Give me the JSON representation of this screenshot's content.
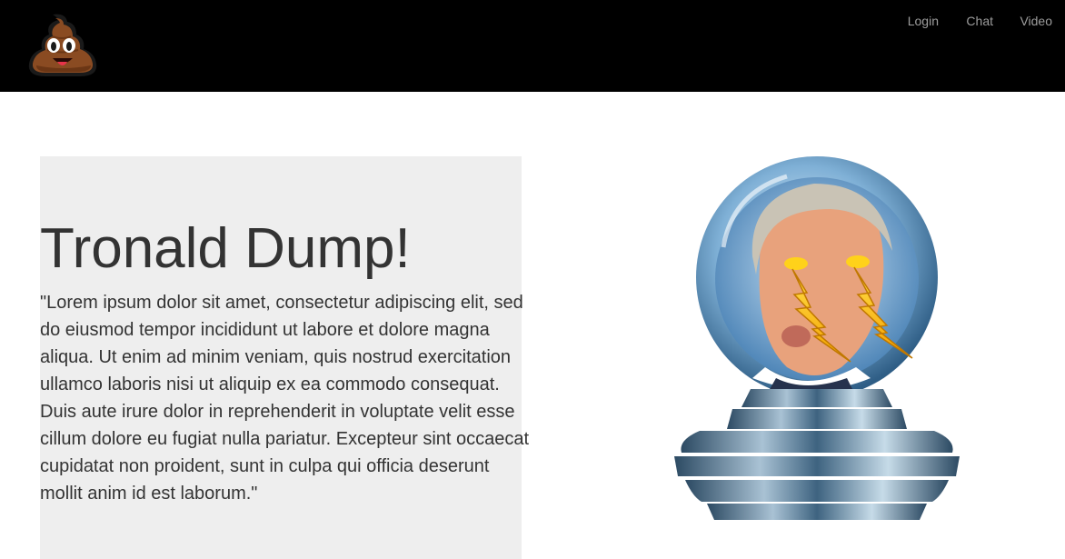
{
  "navbar": {
    "logo_icon": "poop-emoji-icon",
    "links": [
      {
        "label": "Login"
      },
      {
        "label": "Chat"
      },
      {
        "label": "Video"
      }
    ],
    "background_color": "#000000",
    "link_color": "#9d9d9d"
  },
  "hero": {
    "title": "Tronald Dump!",
    "body": "\"Lorem ipsum dolor sit amet, consectetur adipiscing elit, sed do eiusmod tempor incididunt ut labore et dolore magna aliqua. Ut enim ad minim veniam, quis nostrud exercitation ullamco laboris nisi ut aliquip ex ea commodo consequat. Duis aute irure dolor in reprehenderit in voluptate velit esse cillum dolore eu fugiat nulla pariatur. Excepteur sint occaecat cupidatat non proident, sunt in culpa qui officia deserunt mollit anim id est laborum.\"",
    "background_color": "#eeeeee"
  },
  "image": {
    "icon": "crystal-ball-image"
  }
}
